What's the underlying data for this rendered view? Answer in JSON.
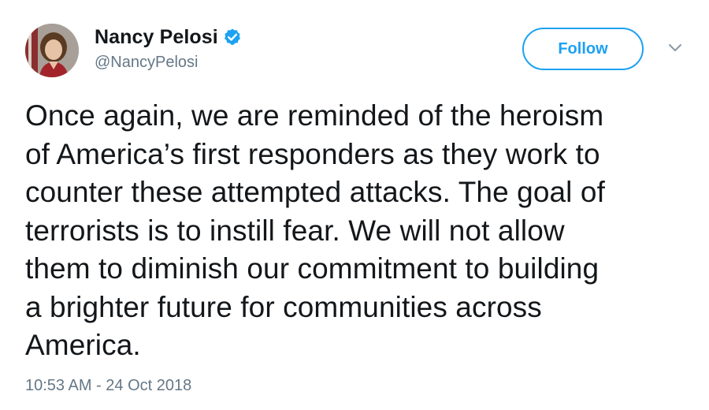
{
  "author": {
    "display_name": "Nancy Pelosi",
    "handle": "@NancyPelosi",
    "verified": true,
    "avatar_icon": "profile-photo",
    "verified_icon": "verified-badge-icon"
  },
  "follow_button": {
    "label": "Follow"
  },
  "menu": {
    "icon": "chevron-down-icon"
  },
  "tweet": {
    "text": "Once again, we are reminded of the heroism\nof America’s first responders as they work to\ncounter these attempted attacks. The goal of\nterrorists is to instill fear. We will not allow\nthem to diminish our commitment to building\na brighter future for communities across\nAmerica.",
    "timestamp": "10:53 AM - 24 Oct 2018"
  },
  "colors": {
    "accent": "#1da1f2",
    "text_primary": "#14171a",
    "text_secondary": "#657786",
    "background": "#ffffff"
  }
}
